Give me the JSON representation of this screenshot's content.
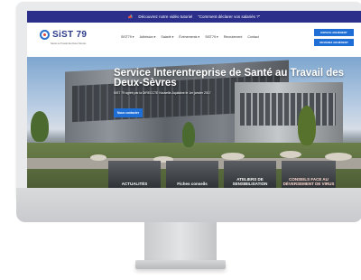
{
  "notice": {
    "text_left": "Découvrez notre vidéo tutoriel",
    "text_right": "\"Comment déclarer vos salariés ?\""
  },
  "header": {
    "logo_text": "SiST 79",
    "logo_subtitle": "Santé au Travail des Deux-Sèvres",
    "nav": [
      {
        "label": "SiST79"
      },
      {
        "label": "Adhésion"
      },
      {
        "label": "Salarié"
      },
      {
        "label": "Événements"
      },
      {
        "label": "SiST79"
      },
      {
        "label": "Recrutement"
      },
      {
        "label": "Contact"
      }
    ],
    "cta_primary": "ESPACE ADHÉRENT",
    "cta_secondary": "DEVENEZ ADHÉRENT"
  },
  "hero": {
    "title": "Service Interentreprise de Santé au Travail des Deux-Sèvres",
    "subtitle": "SiST 79 agréé par la DIRECCTE Nouvelle-Aquitaine le 1er janvier 2017",
    "button": "Nous contacter"
  },
  "cards": [
    {
      "label": "ACTUALITÉS"
    },
    {
      "label": "Fiches conseils"
    },
    {
      "label": "ATELIERS DE SENSIBILISATION"
    },
    {
      "label": "CONSEILS FACE AU DÉVERSEMENT DE VIRUS"
    }
  ],
  "colors": {
    "brand_blue": "#2b2f8a",
    "accent_blue": "#1e6ed6"
  }
}
